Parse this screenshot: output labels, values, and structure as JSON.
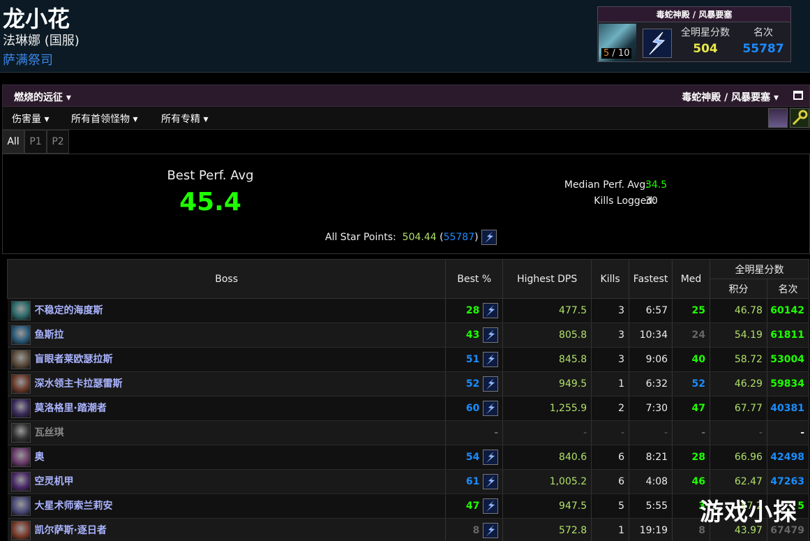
{
  "character": {
    "name": "龙小花",
    "server": "法琳娜 (国服)",
    "class": "萨满祭司"
  },
  "zone_box": {
    "title": "毒蛇神殿 / 风暴要塞",
    "progress_done": "5",
    "progress_total": "/ 10",
    "allstar_label": "全明星分数",
    "allstar_value": "504",
    "rank_label": "名次",
    "rank_value": "55787"
  },
  "toolbar": {
    "left": "燃烧的远征",
    "right": "毒蛇神殿 / 风暴要塞"
  },
  "filters": {
    "metric": "伤害量",
    "bosses": "所有首领怪物",
    "specs": "所有专精"
  },
  "tabs": [
    "All",
    "P1",
    "P2"
  ],
  "summary": {
    "best_perf_label": "Best Perf. Avg",
    "best_perf_value": "45.4",
    "median_label": "Median Perf. Avg:",
    "median_value": "34.5",
    "kills_label": "Kills Logged:",
    "kills_value": "30",
    "allstar_label": "All Star Points:",
    "allstar_points": "504.44",
    "allstar_rank": "55787"
  },
  "table": {
    "headers": {
      "boss": "Boss",
      "best": "Best %",
      "dps": "Highest DPS",
      "kills": "Kills",
      "fastest": "Fastest",
      "med": "Med",
      "allstar": "全明星分数",
      "points": "积分",
      "rank": "名次"
    },
    "rows": [
      {
        "boss": "不稳定的海度斯",
        "best": "28",
        "dps": "477.5",
        "kills": "3",
        "fastest": "6:57",
        "med": "25",
        "points": "46.78",
        "rank": "60142"
      },
      {
        "boss": "鱼斯拉",
        "best": "43",
        "dps": "805.8",
        "kills": "3",
        "fastest": "10:34",
        "med": "24",
        "points": "54.19",
        "rank": "61811"
      },
      {
        "boss": "盲眼者莱欧瑟拉斯",
        "best": "51",
        "dps": "845.8",
        "kills": "3",
        "fastest": "9:06",
        "med": "40",
        "points": "58.72",
        "rank": "53004"
      },
      {
        "boss": "深水领主卡拉瑟雷斯",
        "best": "52",
        "dps": "949.5",
        "kills": "1",
        "fastest": "6:32",
        "med": "52",
        "points": "46.29",
        "rank": "59834"
      },
      {
        "boss": "莫洛格里·踏潮者",
        "best": "60",
        "dps": "1,255.9",
        "kills": "2",
        "fastest": "7:30",
        "med": "47",
        "points": "67.77",
        "rank": "40381"
      },
      {
        "boss": "瓦丝琪",
        "best": "-",
        "dps": "-",
        "kills": "-",
        "fastest": "-",
        "med": "-",
        "points": "-",
        "rank": "-"
      },
      {
        "boss": "奥",
        "best": "54",
        "dps": "840.6",
        "kills": "6",
        "fastest": "8:21",
        "med": "28",
        "points": "66.96",
        "rank": "42498"
      },
      {
        "boss": "空灵机甲",
        "best": "61",
        "dps": "1,005.2",
        "kills": "6",
        "fastest": "4:08",
        "med": "46",
        "points": "62.47",
        "rank": "47263"
      },
      {
        "boss": "大星术师索兰莉安",
        "best": "47",
        "dps": "947.5",
        "kills": "5",
        "fastest": "5:55",
        "med": "3",
        "points": "57.2",
        "rank": "5"
      },
      {
        "boss": "凯尔萨斯·逐日者",
        "best": "8",
        "dps": "572.8",
        "kills": "1",
        "fastest": "19:19",
        "med": "8",
        "points": "43.97",
        "rank": "67479"
      }
    ]
  },
  "watermark": "游戏小探",
  "colors": {
    "green": "#1eff00",
    "blue": "#1a8cff",
    "grey": "#666666",
    "yellow_green": "#b0e06a",
    "boss_blue": "#aab4ff"
  }
}
